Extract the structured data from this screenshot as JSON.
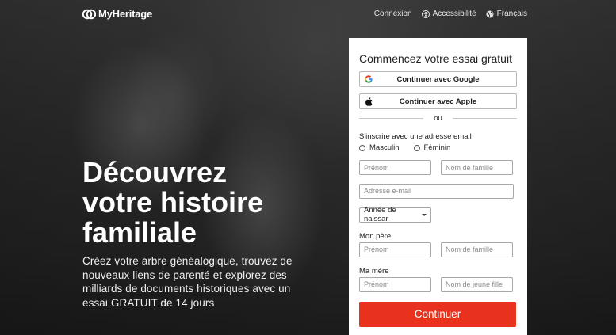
{
  "header": {
    "logo_text": "MyHeritage",
    "nav": {
      "login": "Connexion",
      "accessibility": "Accessibilité",
      "language": "Français"
    }
  },
  "hero": {
    "headline_line1": "Découvrez",
    "headline_line2": "votre histoire",
    "headline_line3": "familiale",
    "subtext": "Créez votre arbre généalogique, trouvez de nouveaux liens de parenté et explorez des milliards de documents historiques avec un essai GRATUIT de 14 jours"
  },
  "form": {
    "title": "Commencez votre essai gratuit",
    "google_label": "Continuer avec Google",
    "apple_label": "Continuer avec Apple",
    "divider_text": "ou",
    "email_signup_label": "S'inscrire avec une adresse email",
    "gender": {
      "male": "Masculin",
      "female": "Féminin"
    },
    "first_name_placeholder": "Prénom",
    "last_name_placeholder": "Nom de famille",
    "email_placeholder": "Adresse e-mail",
    "birth_year_label": "Année de naissar",
    "father_label": "Mon père",
    "father_first_name_placeholder": "Prénom",
    "father_last_name_placeholder": "Nom de famille",
    "mother_label": "Ma mère",
    "mother_first_name_placeholder": "Prénom",
    "mother_maiden_name_placeholder": "Nom de jeune fille",
    "submit_label": "Continuer"
  },
  "colors": {
    "accent": "#e8321e",
    "card_bg": "#ffffff"
  }
}
